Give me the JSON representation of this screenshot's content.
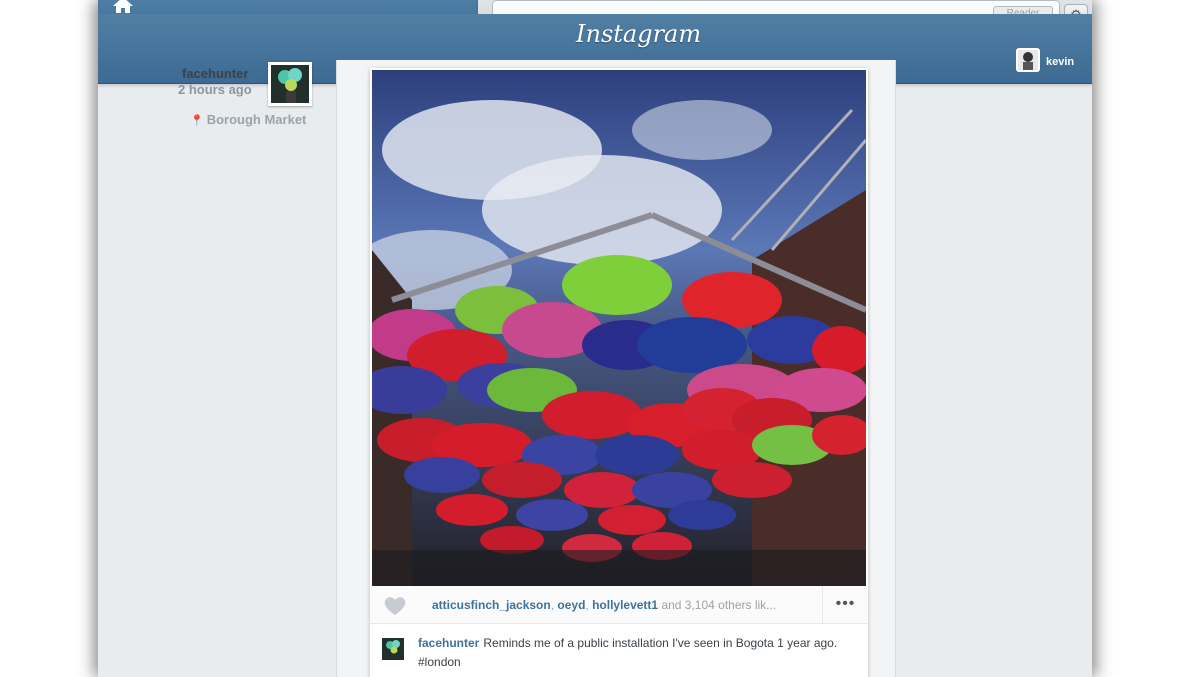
{
  "browser": {
    "reader_label": "Reader"
  },
  "header": {
    "logo_text": "Instagram",
    "username": "kevin"
  },
  "post": {
    "author": "facehunter",
    "time": "2 hours ago",
    "location": "Borough Market",
    "likes": {
      "user1": "atticusfinch_jackson",
      "sep1": ", ",
      "user2": "oeyd",
      "sep2": ", ",
      "user3": "hollylevett1",
      "rest": " and 3,104 others lik..."
    },
    "comment": {
      "user": "facehunter",
      "text": "Reminds me of a public installation I've seen in Bogota 1 year ago. #london"
    }
  },
  "icons": {
    "home": "home-icon",
    "heart": "heart-icon",
    "more": "more-icon",
    "location": "location-pin-icon",
    "settings": "gear-icon",
    "reload": "reload-icon"
  },
  "colors": {
    "header": "#4a789f",
    "link": "#3f729b",
    "background": "#e9ecef"
  }
}
